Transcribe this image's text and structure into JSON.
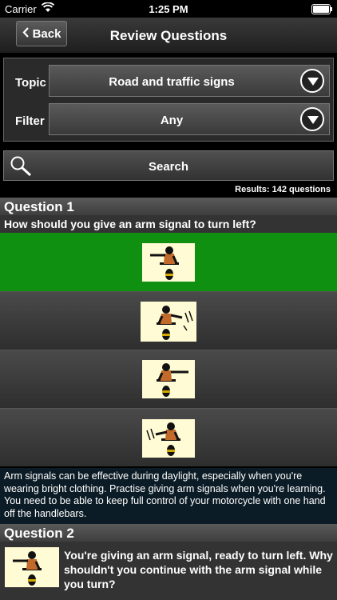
{
  "status_bar": {
    "carrier": "Carrier",
    "time": "1:25 PM"
  },
  "nav": {
    "back_label": "Back",
    "title": "Review Questions"
  },
  "filters": {
    "topic_label": "Topic",
    "topic_value": "Road and traffic signs",
    "filter_label": "Filter",
    "filter_value": "Any"
  },
  "search": {
    "label": "Search"
  },
  "results_text": "Results: 142 questions",
  "questions": [
    {
      "heading": "Question 1",
      "text": "How should you give an arm signal to turn left?",
      "answers": [
        {
          "image": "rider-left-arm-straight",
          "status": "correct"
        },
        {
          "image": "rider-right-arm-waving",
          "status": "normal"
        },
        {
          "image": "rider-right-arm-straight",
          "status": "normal"
        },
        {
          "image": "rider-left-arm-waving",
          "status": "normal"
        }
      ],
      "explanation": "Arm signals can be effective during daylight, especially when you're wearing bright clothing. Practise giving arm signals when you're learning. You need to be able to keep full control of your motorcycle with one hand off the handlebars."
    },
    {
      "heading": "Question 2",
      "text": "You're giving an arm signal, ready to turn left. Why shouldn't you continue with the arm signal while you turn?"
    }
  ],
  "colors": {
    "correct": "#109010",
    "explanation_bg": "#0c1c26",
    "image_bg": "#fffbd4"
  }
}
